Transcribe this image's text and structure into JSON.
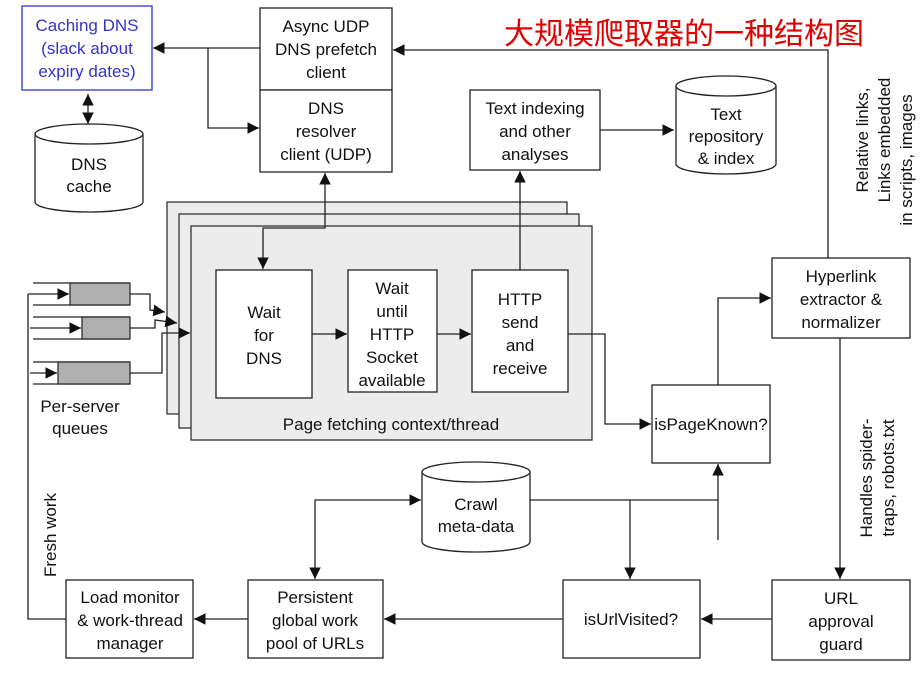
{
  "title": "大规模爬取器的一种结构图",
  "colors": {
    "title": "#e00000",
    "caching_dns": "#3333cc",
    "panel": "#ececec",
    "queue": "#b0b0b0"
  },
  "nodes": {
    "caching_dns": [
      "Caching DNS",
      "(slack about",
      "expiry dates)"
    ],
    "dns_cache": [
      "DNS",
      "cache"
    ],
    "async_udp": [
      "Async UDP",
      "DNS prefetch",
      "client"
    ],
    "dns_resolver": [
      "DNS",
      "resolver",
      "client (UDP)"
    ],
    "text_indexing": [
      "Text indexing",
      "and other",
      "analyses"
    ],
    "text_repository": [
      "Text",
      "repository",
      "& index"
    ],
    "wait_dns": [
      "Wait",
      "for",
      "DNS"
    ],
    "wait_http": [
      "Wait",
      "until",
      "HTTP",
      "Socket",
      "available"
    ],
    "http_send": [
      "HTTP",
      "send",
      "and",
      "receive"
    ],
    "page_fetching": "Page fetching context/thread",
    "per_server_queues": [
      "Per-server",
      "queues"
    ],
    "hyperlink": [
      "Hyperlink",
      "extractor &",
      "normalizer"
    ],
    "is_page_known": "isPageKnown?",
    "crawl_meta": [
      "Crawl",
      "meta-data"
    ],
    "url_guard": [
      "URL",
      "approval",
      "guard"
    ],
    "is_url_visited": "isUrlVisited?",
    "persistent_pool": [
      "Persistent",
      "global work",
      "pool of URLs"
    ],
    "load_monitor": [
      "Load monitor",
      "& work-thread",
      "manager"
    ]
  },
  "annotations": {
    "fresh_work": "Fresh work",
    "relative_links": [
      "Relative links,",
      "Links embedded",
      "in scripts, images"
    ],
    "handles": [
      "Handles spider-",
      "traps, robots.txt"
    ]
  }
}
